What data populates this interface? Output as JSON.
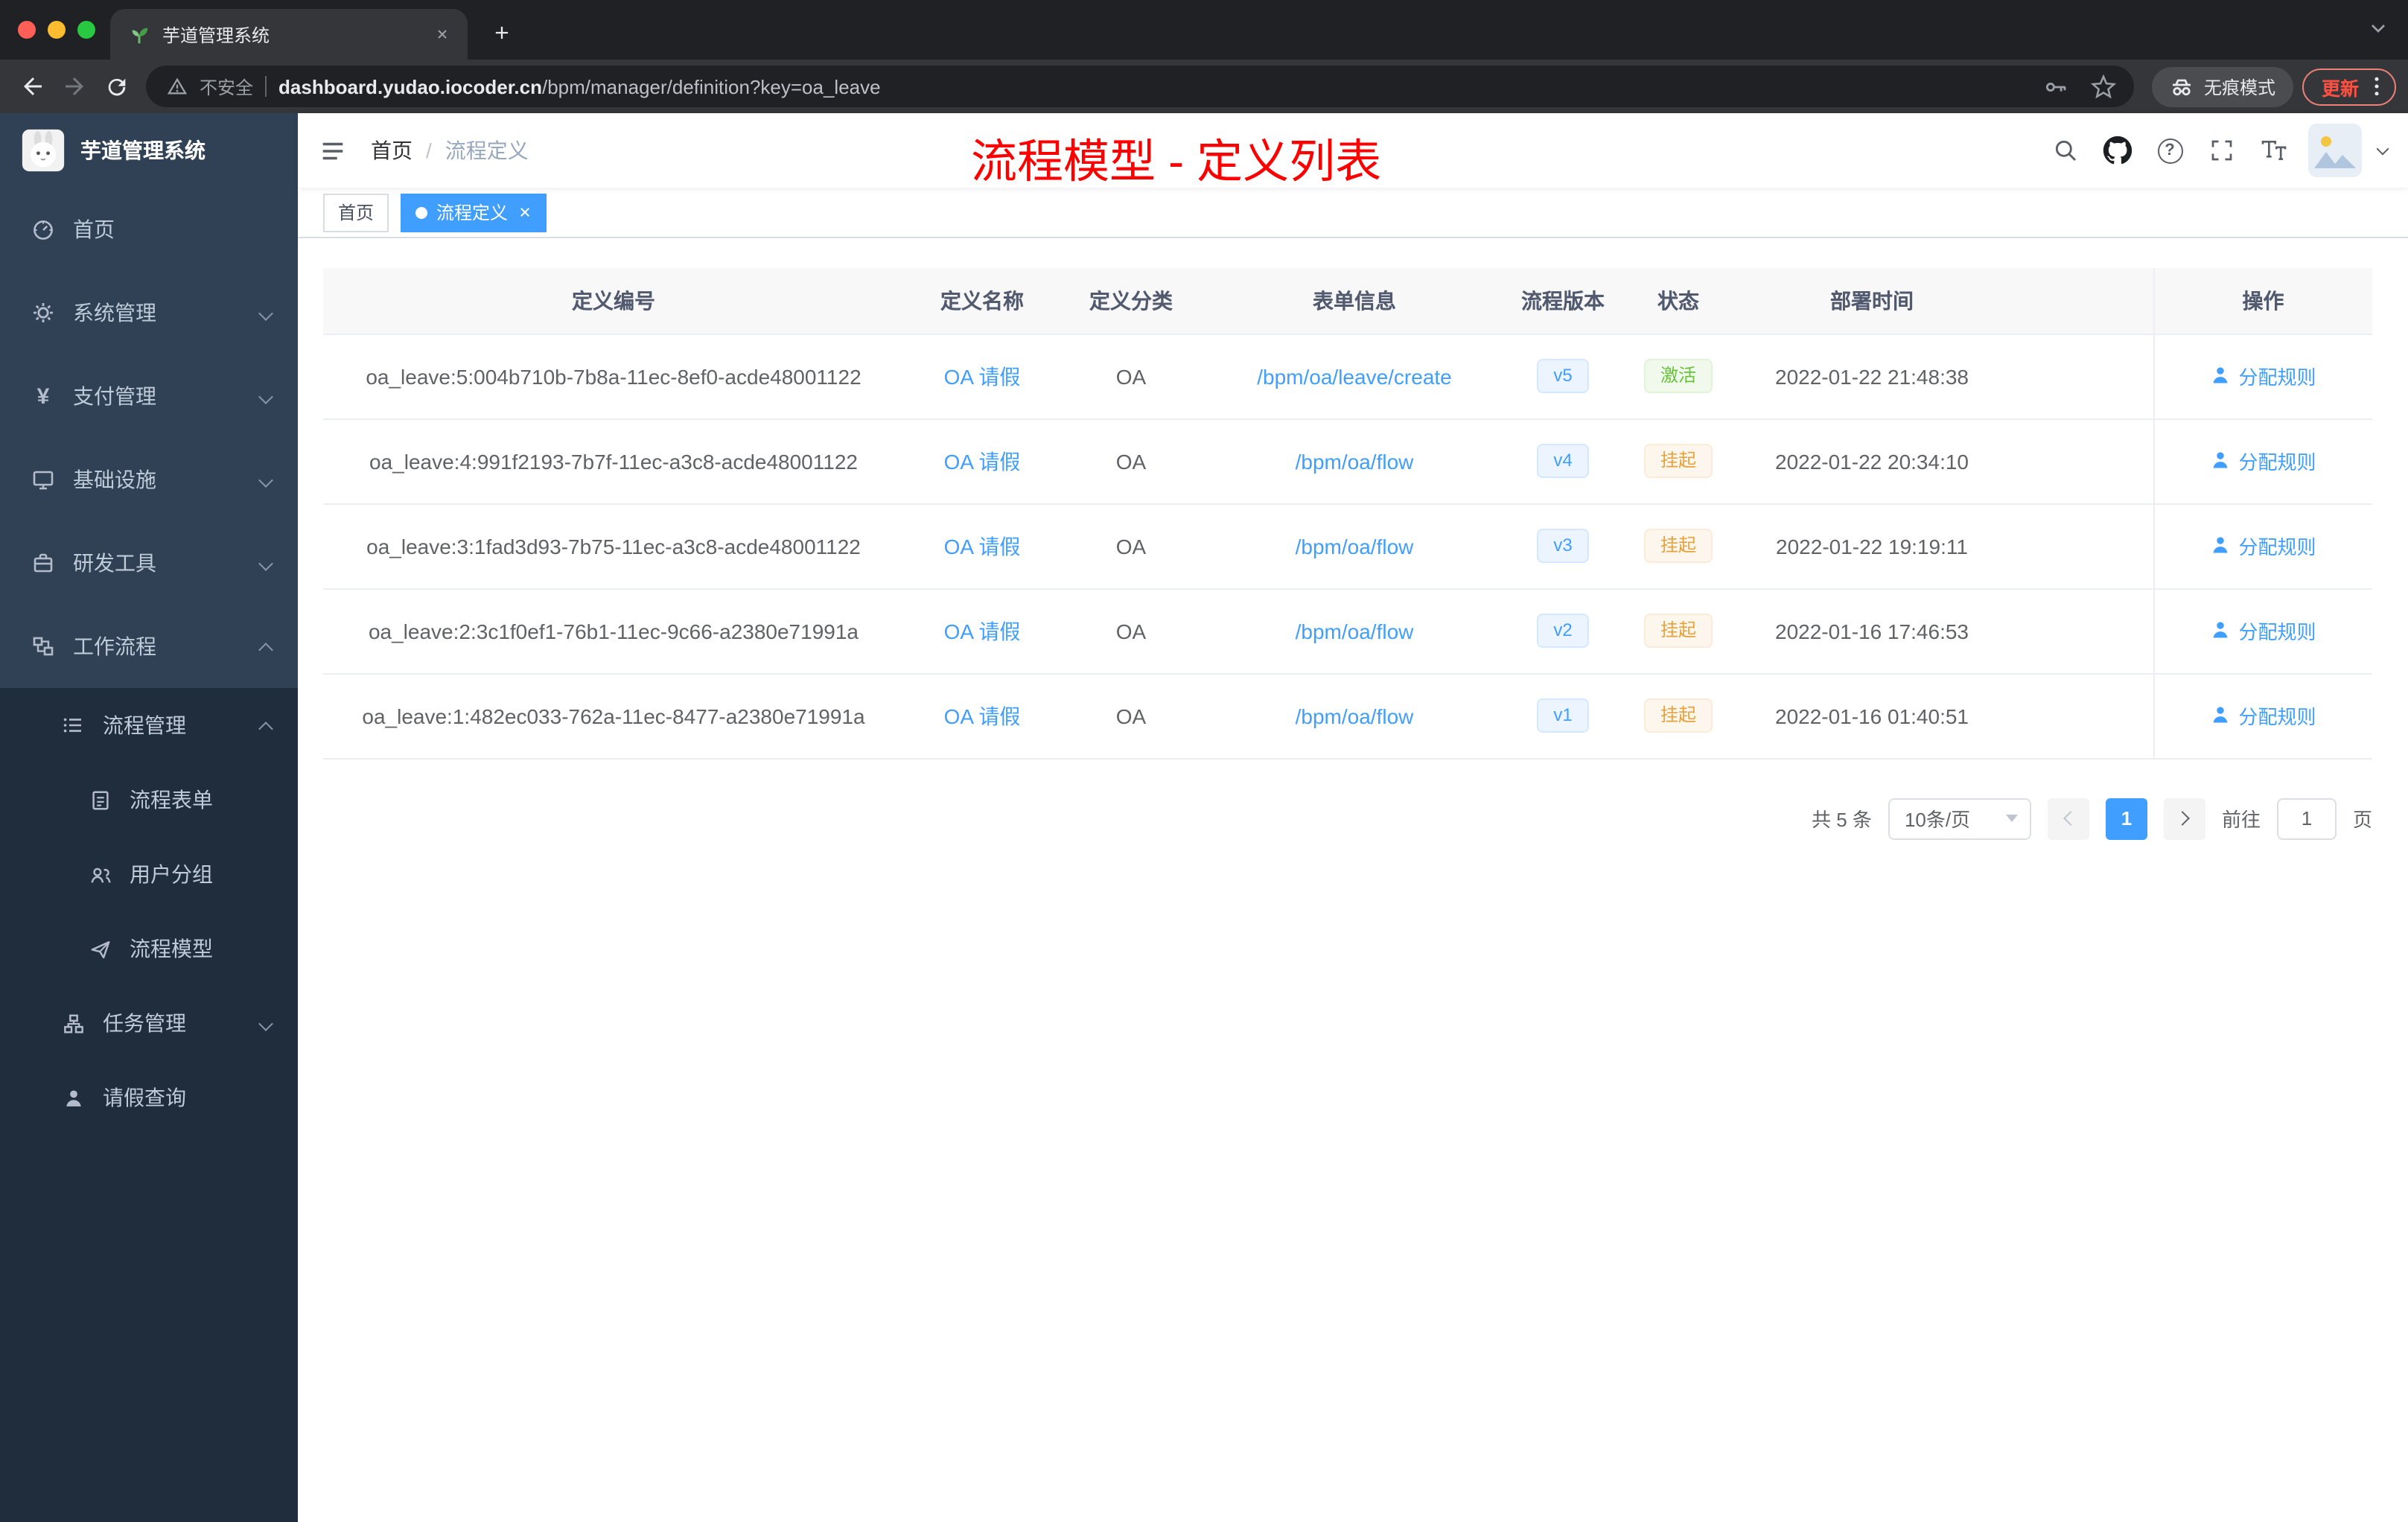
{
  "browser": {
    "tab_title": "芋道管理系统",
    "security_label": "不安全",
    "url_host": "dashboard.yudao.iocoder.cn",
    "url_path": "/bpm/manager/definition?key=oa_leave",
    "incognito_label": "无痕模式",
    "update_label": "更新"
  },
  "sidebar": {
    "logo_title": "芋道管理系统",
    "yen_glyph": "¥",
    "items": [
      {
        "label": "首页"
      },
      {
        "label": "系统管理"
      },
      {
        "label": "支付管理"
      },
      {
        "label": "基础设施"
      },
      {
        "label": "研发工具"
      },
      {
        "label": "工作流程"
      },
      {
        "label": "流程管理"
      },
      {
        "label": "流程表单"
      },
      {
        "label": "用户分组"
      },
      {
        "label": "流程模型"
      },
      {
        "label": "任务管理"
      },
      {
        "label": "请假查询"
      }
    ]
  },
  "header": {
    "breadcrumb_home": "首页",
    "breadcrumb_separator": "/",
    "breadcrumb_current": "流程定义",
    "annotation": "流程模型 - 定义列表",
    "help_glyph": "?"
  },
  "tags": {
    "home": "首页",
    "current": "流程定义"
  },
  "table": {
    "columns": [
      "定义编号",
      "定义名称",
      "定义分类",
      "表单信息",
      "流程版本",
      "状态",
      "部署时间",
      "操作"
    ],
    "rows": [
      {
        "id": "oa_leave:5:004b710b-7b8a-11ec-8ef0-acde48001122",
        "name": "OA 请假",
        "category": "OA",
        "form": "/bpm/oa/leave/create",
        "version": "v5",
        "status": "激活",
        "time": "2022-01-22 21:48:38",
        "action": "分配规则"
      },
      {
        "id": "oa_leave:4:991f2193-7b7f-11ec-a3c8-acde48001122",
        "name": "OA 请假",
        "category": "OA",
        "form": "/bpm/oa/flow",
        "version": "v4",
        "status": "挂起",
        "time": "2022-01-22 20:34:10",
        "action": "分配规则"
      },
      {
        "id": "oa_leave:3:1fad3d93-7b75-11ec-a3c8-acde48001122",
        "name": "OA 请假",
        "category": "OA",
        "form": "/bpm/oa/flow",
        "version": "v3",
        "status": "挂起",
        "time": "2022-01-22 19:19:11",
        "action": "分配规则"
      },
      {
        "id": "oa_leave:2:3c1f0ef1-76b1-11ec-9c66-a2380e71991a",
        "name": "OA 请假",
        "category": "OA",
        "form": "/bpm/oa/flow",
        "version": "v2",
        "status": "挂起",
        "time": "2022-01-16 17:46:53",
        "action": "分配规则"
      },
      {
        "id": "oa_leave:1:482ec033-762a-11ec-8477-a2380e71991a",
        "name": "OA 请假",
        "category": "OA",
        "form": "/bpm/oa/flow",
        "version": "v1",
        "status": "挂起",
        "time": "2022-01-16 01:40:51",
        "action": "分配规则"
      }
    ]
  },
  "pagination": {
    "total": "共 5 条",
    "page_size": "10条/页",
    "current_page": "1",
    "goto_label": "前往",
    "goto_value": "1",
    "page_unit": "页"
  },
  "colors": {
    "primary": "#409eff",
    "success": "#67c23a",
    "warning": "#e6a23c",
    "annotation_red": "#ff0000",
    "sidebar_bg": "#304156",
    "sidebar_sub_bg": "#1f2d3d"
  }
}
